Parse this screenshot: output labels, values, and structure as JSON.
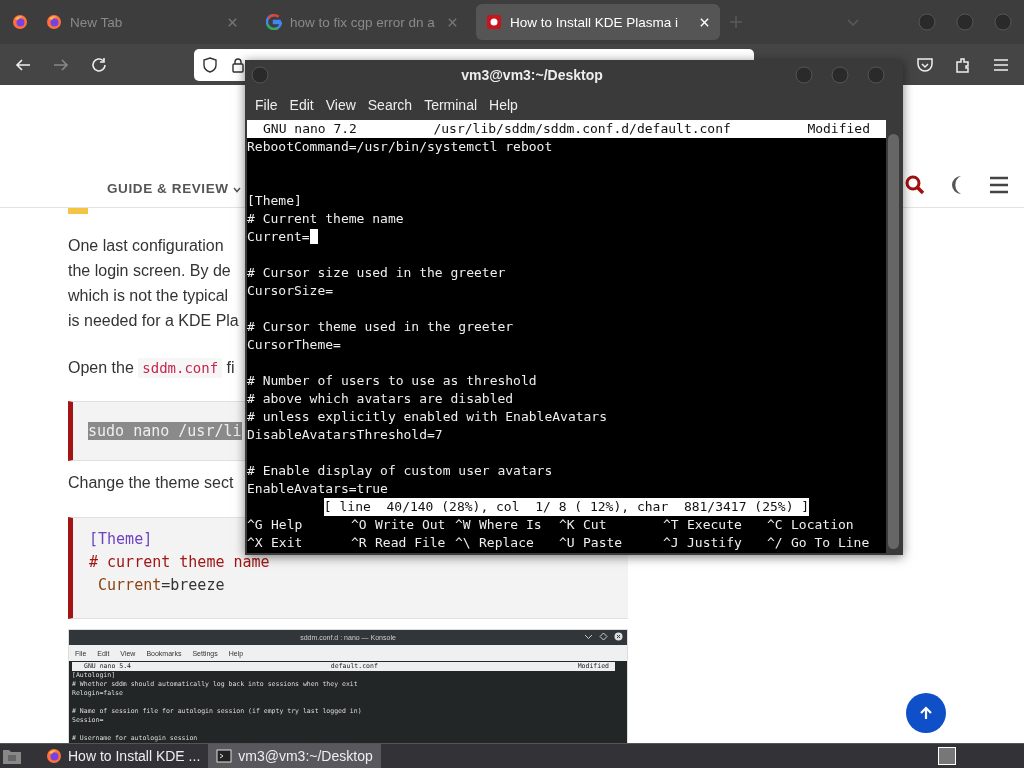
{
  "browser": {
    "tabs": [
      {
        "kind": "firefox",
        "title": "New Tab",
        "selected": false
      },
      {
        "kind": "google",
        "title": "how to fix cgp error dn a",
        "selected": false
      },
      {
        "kind": "site",
        "title": "How to Install KDE Plasma i",
        "selected": true
      }
    ]
  },
  "page": {
    "nav_label": "GUIDE & REVIEW",
    "intro_lines": [
      "One last configuration",
      "the login screen. By de",
      "which is not the typical",
      "is needed for a KDE Pla"
    ],
    "open_text": {
      "before": "Open the ",
      "code": "sddm.conf",
      "after": " fi"
    },
    "command": "sudo nano /usr/li",
    "change_text": "Change the theme sect",
    "theme_code": [
      {
        "kind": "section",
        "text": "[Theme]"
      },
      {
        "kind": "comment",
        "text": "# current theme name"
      },
      {
        "kind": "assign",
        "key": " Current",
        "value": "=breeze"
      }
    ],
    "screenshot": {
      "title": "sddm.conf.d : nano — Konsole",
      "menu": [
        "File",
        "Edit",
        "View",
        "Bookmarks",
        "Settings",
        "Help"
      ],
      "header": [
        "GNU nano 5.4",
        "default.conf",
        "Modified"
      ],
      "blocks": [
        [
          "[Autologin]",
          "# Whether sddm should automatically log back into sessions when they exit",
          "Relogin=false"
        ],
        [
          "# Name of session file for autologin session (if empty try last logged in)",
          "Session="
        ],
        [
          "# Username for autologin session"
        ]
      ]
    }
  },
  "terminal": {
    "title": "vm3@vm3:~/Desktop",
    "menu": [
      "File",
      "Edit",
      "View",
      "Search",
      "Terminal",
      "Help"
    ],
    "header": [
      "GNU nano 7.2",
      "/usr/lib/sddm/sddm.conf.d/default.conf",
      "Modified"
    ],
    "lines": [
      {
        "kind": "text",
        "text": "RebootCommand=/usr/bin/systemctl reboot",
        "cursor": false
      },
      {
        "kind": "blank"
      },
      {
        "kind": "blank"
      },
      {
        "kind": "text",
        "text": "[Theme]",
        "cursor": false
      },
      {
        "kind": "text",
        "text": "# Current theme name",
        "cursor": false
      },
      {
        "kind": "text",
        "text": "Current=",
        "cursor": true
      },
      {
        "kind": "blank"
      },
      {
        "kind": "text",
        "text": "# Cursor size used in the greeter",
        "cursor": false
      },
      {
        "kind": "text",
        "text": "CursorSize=",
        "cursor": false
      },
      {
        "kind": "blank"
      },
      {
        "kind": "text",
        "text": "# Cursor theme used in the greeter",
        "cursor": false
      },
      {
        "kind": "text",
        "text": "CursorTheme=",
        "cursor": false
      },
      {
        "kind": "blank"
      },
      {
        "kind": "text",
        "text": "# Number of users to use as threshold",
        "cursor": false
      },
      {
        "kind": "text",
        "text": "# above which avatars are disabled",
        "cursor": false
      },
      {
        "kind": "text",
        "text": "# unless explicitly enabled with EnableAvatars",
        "cursor": false
      },
      {
        "kind": "text",
        "text": "DisableAvatarsThreshold=7",
        "cursor": false
      },
      {
        "kind": "blank"
      },
      {
        "kind": "text",
        "text": "# Enable display of custom user avatars",
        "cursor": false
      },
      {
        "kind": "text",
        "text": "EnableAvatars=true",
        "cursor": false
      }
    ],
    "status": "[ line  40/140 (28%), col  1/ 8 ( 12%), char  881/3417 (25%) ]",
    "shortcuts": [
      {
        "key": "^G",
        "label": "Help"
      },
      {
        "key": "^O",
        "label": "Write Out"
      },
      {
        "key": "^W",
        "label": "Where Is"
      },
      {
        "key": "^K",
        "label": "Cut"
      },
      {
        "key": "^T",
        "label": "Execute"
      },
      {
        "key": "^C",
        "label": "Location"
      },
      {
        "key": "^X",
        "label": "Exit"
      },
      {
        "key": "^R",
        "label": "Read File"
      },
      {
        "key": "^\\",
        "label": "Replace"
      },
      {
        "key": "^U",
        "label": "Paste"
      },
      {
        "key": "^J",
        "label": "Justify"
      },
      {
        "key": "^/",
        "label": "Go To Line"
      }
    ]
  },
  "taskbar": {
    "tasks": [
      {
        "kind": "browser",
        "label": "How to Install KDE ...",
        "selected": false
      },
      {
        "kind": "terminal",
        "label": "vm3@vm3:~/Desktop",
        "selected": true
      }
    ]
  }
}
